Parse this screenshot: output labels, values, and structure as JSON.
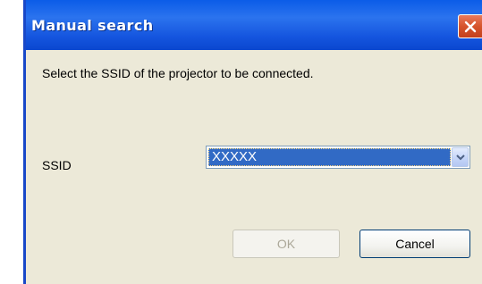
{
  "window": {
    "title": "Manual search",
    "close_icon": "close-icon"
  },
  "content": {
    "instruction": "Select the SSID of the projector to be connected.",
    "ssid_label": "SSID",
    "ssid_select": {
      "value": "XXXXX",
      "arrow_icon": "chevron-down-icon"
    }
  },
  "buttons": {
    "ok_label": "OK",
    "ok_enabled": false,
    "cancel_label": "Cancel"
  },
  "colors": {
    "titlebar": "#0b5ce8",
    "dialog_background": "#ece9d8",
    "selection": "#316ac5",
    "close_button": "#d6542c"
  }
}
